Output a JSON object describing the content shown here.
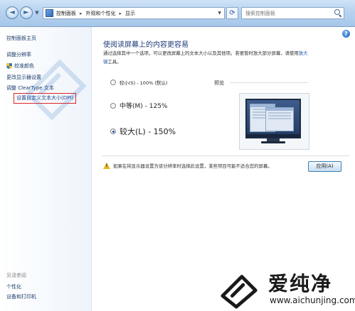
{
  "window": {
    "breadcrumb": [
      "控制面板",
      "外观和个性化",
      "显示"
    ],
    "search_placeholder": "搜索控制面板"
  },
  "sidebar": {
    "home": "控制面板主页",
    "items": [
      "调整分辨率",
      "校准颜色",
      "更改显示器设置",
      "调整 ClearType 文本",
      "设置自定义文本大小(DPI)"
    ],
    "see_also_title": "另请参阅",
    "see_also": [
      "个性化",
      "设备和打印机"
    ]
  },
  "main": {
    "heading": "使阅读屏幕上的内容更容易",
    "description_1": "通过选择其中一个选项，可以更改屏幕上的文本大小以及其他项。若要暂时放大部分屏幕，请使用",
    "description_link_1": "放大",
    "description_link_2": "镜",
    "description_2": "工具。",
    "options": [
      {
        "label": "较小(S) - 100% (默认)",
        "selected": false
      },
      {
        "label": "中等(M) - 125%",
        "selected": false
      },
      {
        "label": "较大(L) - 150%",
        "selected": true
      }
    ],
    "preview_label": "预览",
    "warning": "如果在将显示器设置为该分辨率时选择此设置，某些项目可能不适合您的屏幕。",
    "apply_button": "应用(A)"
  },
  "watermark": {
    "brand": "爱纯净",
    "url": "www.aichunjing.com"
  }
}
